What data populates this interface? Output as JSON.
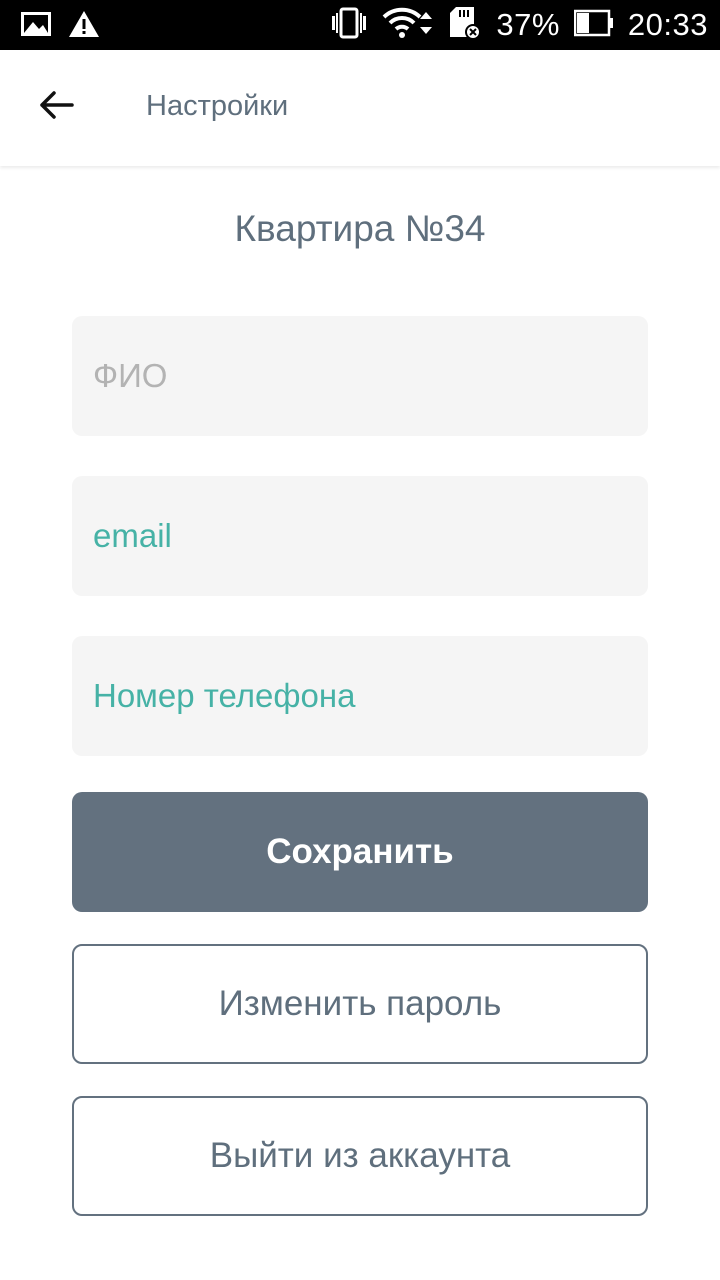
{
  "status_bar": {
    "battery_percent": "37%",
    "time": "20:33",
    "icons": [
      "gallery-icon",
      "warning-icon",
      "vibrate-icon",
      "wifi-icon",
      "sd-card-icon",
      "battery-icon"
    ]
  },
  "toolbar": {
    "back_icon": "arrow-left-icon",
    "title": "Настройки"
  },
  "page": {
    "heading": "Квартира №34"
  },
  "form": {
    "full_name": {
      "value": "",
      "placeholder": "ФИО"
    },
    "email": {
      "value": "",
      "placeholder": "email"
    },
    "phone": {
      "value": "",
      "placeholder": "Номер телефона"
    }
  },
  "actions": {
    "save_label": "Сохранить",
    "change_password_label": "Изменить пароль",
    "logout_label": "Выйти из аккаунта"
  },
  "colors": {
    "accent": "#46b2a6",
    "primary_button": "#63717f",
    "text": "#5f6f7d",
    "field_background": "#f5f5f5"
  }
}
